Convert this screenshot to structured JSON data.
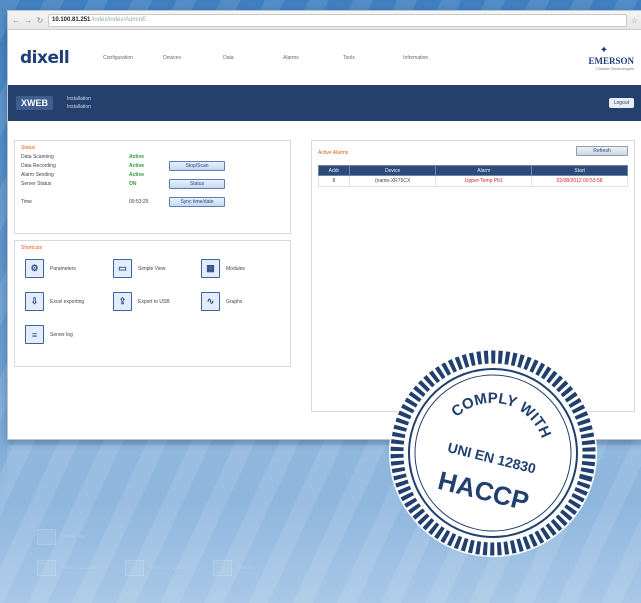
{
  "browser": {
    "url_host": "10.100.81.251",
    "url_path": "/index/index/AdminE"
  },
  "brand": {
    "logo": "dixell",
    "partner": "EMERSON",
    "partner_sub": "Climate Technologies"
  },
  "menu": [
    "Configuration",
    "Devices",
    "Data",
    "Alarms",
    "Tools",
    "Information"
  ],
  "band": {
    "app": "XWEB",
    "line1": "Installation",
    "line2": "Installation",
    "logout": "Logout"
  },
  "status": {
    "title": "Status",
    "rows": [
      {
        "label": "Data Scanning",
        "value": "Active"
      },
      {
        "label": "Data Recording",
        "value": "Active",
        "button": "Stop/Scan"
      },
      {
        "label": "Alarm Sending",
        "value": "Active"
      },
      {
        "label": "Server Status",
        "value": "ON",
        "button": "Status"
      },
      {
        "label": "Time",
        "value": "09:53:25",
        "button": "Sync time/date"
      }
    ]
  },
  "shortcuts": {
    "title": "Shortcuts",
    "items": [
      {
        "label": "Parameters",
        "icon": "wrench-icon",
        "glyph": "⚙"
      },
      {
        "label": "Simple View",
        "icon": "monitor-icon",
        "glyph": "▭"
      },
      {
        "label": "Modules",
        "icon": "grid-icon",
        "glyph": "▦"
      },
      {
        "label": "Excel exporting",
        "icon": "export-icon",
        "glyph": "⇩"
      },
      {
        "label": "Export to USB",
        "icon": "usb-icon",
        "glyph": "⇪"
      },
      {
        "label": "Graphs",
        "icon": "chart-icon",
        "glyph": "∿"
      },
      {
        "label": "Server log",
        "icon": "list-icon",
        "glyph": "≡"
      }
    ]
  },
  "alarms": {
    "title": "Active Alarms",
    "refresh": "Refresh",
    "columns": [
      "Addr",
      "Device",
      "Alarm",
      "Start"
    ],
    "rows": [
      {
        "addr": "8",
        "device": "(name-XR75CX",
        "alarm": "Upper-Temp Pb1",
        "start": "02/08/2012 09:53:58"
      }
    ]
  },
  "stamp": {
    "line1": "COMPLY WITH",
    "line2": "UNI EN 12830",
    "line3": "HACCP"
  },
  "reflection": {
    "items": [
      "Server log",
      "Excel exporting",
      "Export to USB",
      "Graphs"
    ]
  }
}
